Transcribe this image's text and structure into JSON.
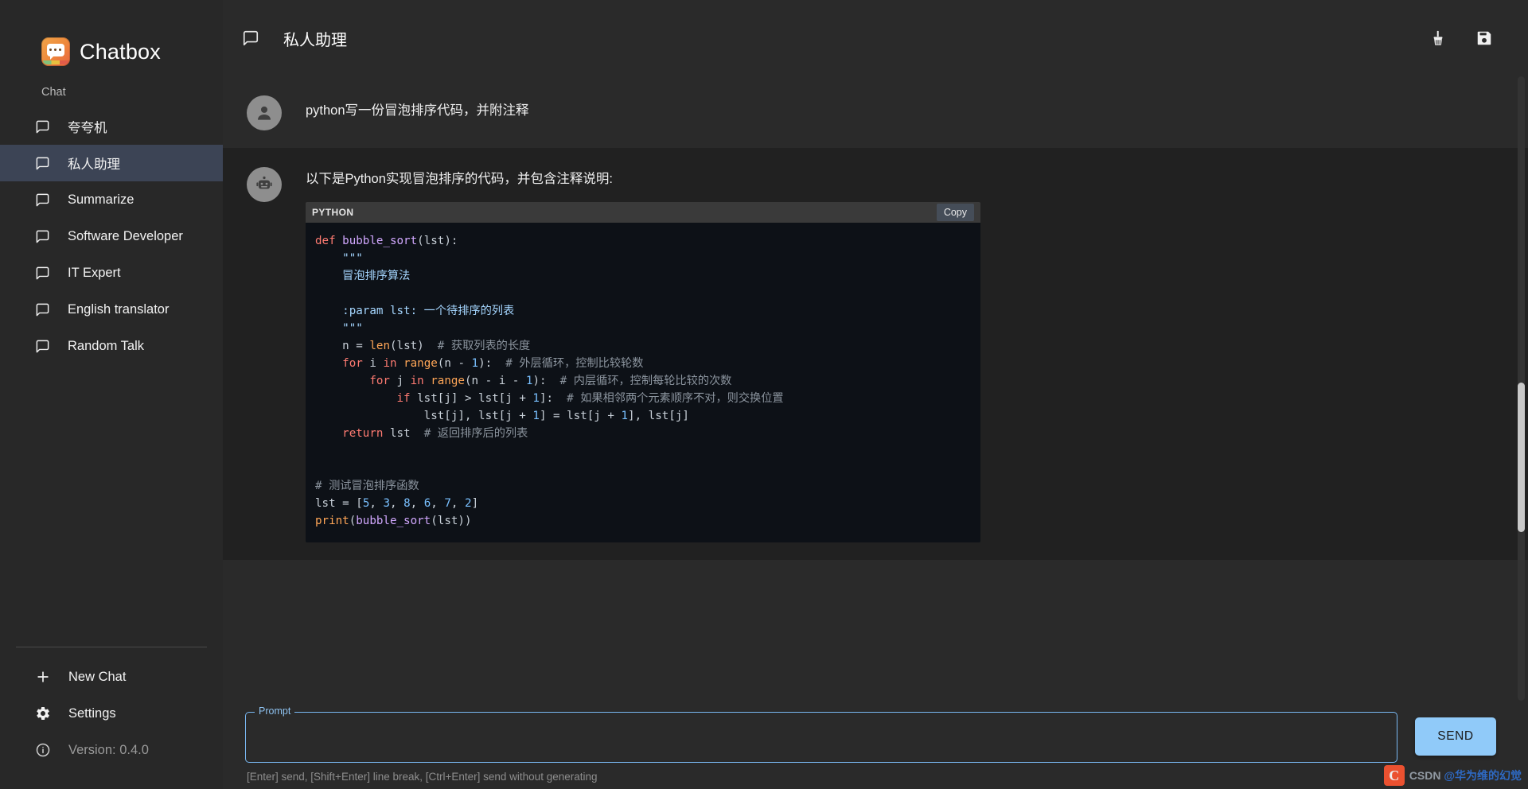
{
  "app": {
    "brand": "Chatbox",
    "logo_icon": "chatbox-logo-icon"
  },
  "sidebar": {
    "section_label": "Chat",
    "items": [
      {
        "label": "夸夸机",
        "icon": "message-square-icon",
        "active": false
      },
      {
        "label": "私人助理",
        "icon": "message-square-icon",
        "active": true
      },
      {
        "label": "Summarize",
        "icon": "message-square-icon",
        "active": false
      },
      {
        "label": "Software Developer",
        "icon": "message-square-icon",
        "active": false
      },
      {
        "label": "IT Expert",
        "icon": "message-square-icon",
        "active": false
      },
      {
        "label": "English translator",
        "icon": "message-square-icon",
        "active": false
      },
      {
        "label": "Random Talk",
        "icon": "message-square-icon",
        "active": false
      }
    ],
    "bottom": {
      "new_chat": "New Chat",
      "new_chat_icon": "plus-icon",
      "settings": "Settings",
      "settings_icon": "gear-icon",
      "version": "Version: 0.4.0",
      "version_icon": "info-circle-icon"
    }
  },
  "topbar": {
    "title": "私人助理",
    "title_icon": "message-square-icon",
    "clean_icon": "broom-icon",
    "save_icon": "floppy-disk-icon"
  },
  "conversation": {
    "user_message": {
      "avatar_icon": "user-avatar-icon",
      "text": "python写一份冒泡排序代码，并附注释"
    },
    "assistant_message": {
      "avatar_icon": "robot-avatar-icon",
      "text": "以下是Python实现冒泡排序的代码，并包含注释说明:",
      "code_block": {
        "language_label": "PYTHON",
        "copy_label": "Copy",
        "code": "def bubble_sort(lst):\n    \"\"\"\n    冒泡排序算法\n\n    :param lst: 一个待排序的列表\n    \"\"\"\n    n = len(lst)  # 获取列表的长度\n    for i in range(n - 1):  # 外层循环，控制比较轮数\n        for j in range(n - i - 1):  # 内层循环，控制每轮比较的次数\n            if lst[j] > lst[j + 1]:  # 如果相邻两个元素顺序不对，则交换位置\n                lst[j], lst[j + 1] = lst[j + 1], lst[j]\n    return lst  # 返回排序后的列表\n\n\n# 测试冒泡排序函数\nlst = [5, 3, 8, 6, 7, 2]\nprint(bubble_sort(lst))"
      }
    }
  },
  "composer": {
    "prompt_legend": "Prompt",
    "prompt_value": "",
    "prompt_placeholder": "",
    "hint": "[Enter] send, [Shift+Enter] line break, [Ctrl+Enter] send without generating",
    "send_label": "SEND"
  },
  "watermark": {
    "brand": "CSDN",
    "author": "@华为维的幻觉"
  },
  "colors": {
    "accent": "#90caf9",
    "sidebar_bg": "#282828",
    "main_bg": "#2a2a2a",
    "assistant_bg": "#212121",
    "active_item": "#3c4455",
    "code_bg": "#0d1117"
  }
}
